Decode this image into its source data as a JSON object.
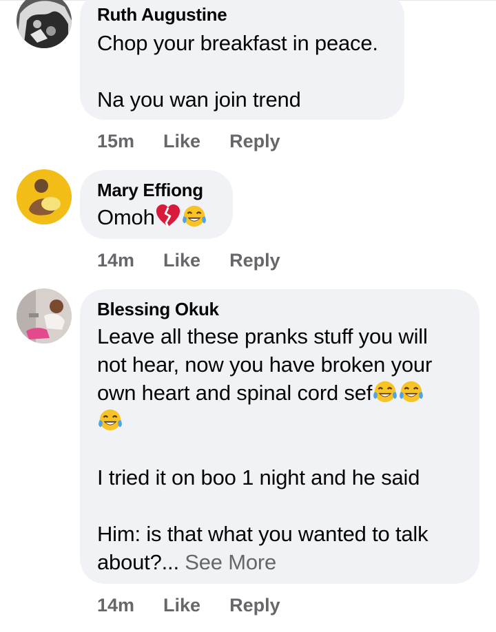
{
  "comments": [
    {
      "author": "Ruth Augustine",
      "text": "Chop your breakfast in peace.\n\nNa you wan join trend",
      "time": "15m",
      "like_label": "Like",
      "reply_label": "Reply"
    },
    {
      "author": "Mary Effiong",
      "text": "Omoh",
      "emoji": [
        "broken-heart-emoji",
        "tears-of-joy-emoji"
      ],
      "time": "14m",
      "like_label": "Like",
      "reply_label": "Reply"
    },
    {
      "author": "Blessing Okuk",
      "text_line1": "Leave all these pranks stuff you will",
      "text_line2": "not hear, now you have broken your",
      "text_line3": "own heart and spinal cord sef",
      "text_rest": "I tried it on boo 1 night and he said\n\nHim: is that what you wanted to talk\nabout?...",
      "see_more_label": " See More",
      "time": "14m",
      "like_label": "Like",
      "reply_label": "Reply"
    }
  ],
  "colors": {
    "bubble": "#f0f2f5",
    "meta": "#65676b",
    "text": "#050505"
  }
}
